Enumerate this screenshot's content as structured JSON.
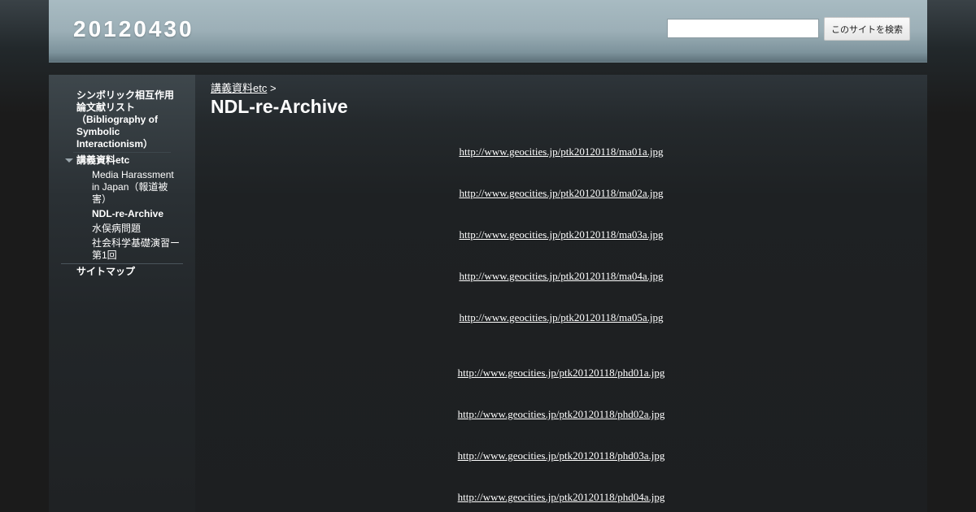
{
  "header": {
    "site_title": "20120430",
    "search_placeholder": "",
    "search_button_label": "このサイトを検索"
  },
  "sidebar": {
    "item1_line1": "シンボリック相互作用",
    "item1_line2": "論文献リスト",
    "item1_line3": "（Bibliography of",
    "item1_line4": "Symbolic",
    "item1_line5": "Interactionism）",
    "item2_label": "講義資料etc",
    "sub1_line1": "Media Harassment",
    "sub1_line2": "in Japan（報道被",
    "sub1_line3": "害）",
    "sub2_label": "NDL-re-Archive",
    "sub3_label": "水俣病問題",
    "sub4_line1": "社会科学基礎演習ー",
    "sub4_line2": "第1回",
    "item3_label": "サイトマップ"
  },
  "main": {
    "breadcrumb_link": "講義資料etc",
    "breadcrumb_sep": " > ",
    "page_title": "NDL-re-Archive",
    "links": [
      "http://www.geocities.jp/ptk20120118/ma01a.jpg",
      "http://www.geocities.jp/ptk20120118/ma02a.jpg",
      "http://www.geocities.jp/ptk20120118/ma03a.jpg",
      "http://www.geocities.jp/ptk20120118/ma04a.jpg",
      "http://www.geocities.jp/ptk20120118/ma05a.jpg",
      "http://www.geocities.jp/ptk20120118/phd01a.jpg",
      "http://www.geocities.jp/ptk20120118/phd02a.jpg",
      "http://www.geocities.jp/ptk20120118/phd03a.jpg",
      "http://www.geocities.jp/ptk20120118/phd04a.jpg"
    ]
  }
}
